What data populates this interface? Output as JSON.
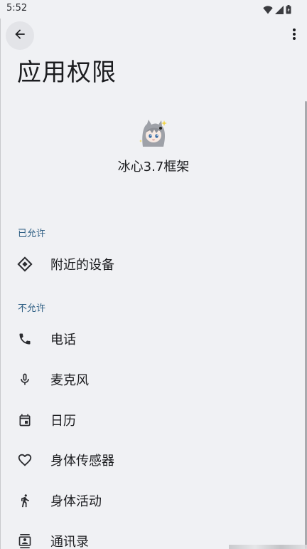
{
  "status_bar": {
    "time": "5:52",
    "icons": [
      "wifi-icon",
      "cell-signal-icon",
      "battery-icon"
    ]
  },
  "app_bar": {
    "back_icon": "arrow-back-icon",
    "menu_icon": "more-vertical-icon",
    "title": "应用权限"
  },
  "app": {
    "name": "冰心3.7框架",
    "icon": "anime-cat-girl-avatar"
  },
  "sections": {
    "allowed": {
      "header": "已允许",
      "items": [
        {
          "label": "附近的设备",
          "icon": "nearby-devices-icon"
        }
      ]
    },
    "denied": {
      "header": "不允许",
      "items": [
        {
          "label": "电话",
          "icon": "phone-icon"
        },
        {
          "label": "麦克风",
          "icon": "microphone-icon"
        },
        {
          "label": "日历",
          "icon": "calendar-icon"
        },
        {
          "label": "身体传感器",
          "icon": "heart-icon"
        },
        {
          "label": "身体活动",
          "icon": "walking-icon"
        },
        {
          "label": "通讯录",
          "icon": "contacts-icon"
        }
      ]
    }
  },
  "colors": {
    "background": "#f0f1f4",
    "section_header": "#2f5f84",
    "text": "#1b1c1f"
  }
}
